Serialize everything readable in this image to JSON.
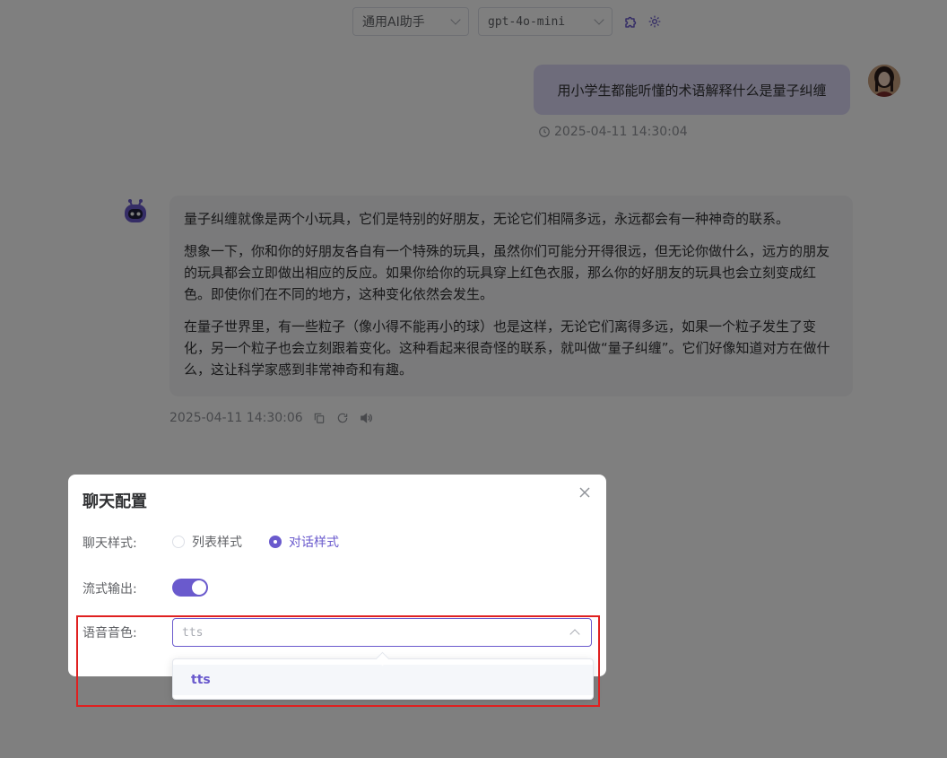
{
  "header": {
    "role_select": "通用AI助手",
    "model_select": "gpt-4o-mini",
    "plugin_icon": "puzzle-icon",
    "settings_icon": "gear-icon"
  },
  "user_message": {
    "text": "用小学生都能听懂的术语解释什么是量子纠缠",
    "time": "2025-04-11 14:30:04"
  },
  "bot_message": {
    "paragraphs": [
      "量子纠缠就像是两个小玩具，它们是特别的好朋友，无论它们相隔多远，永远都会有一种神奇的联系。",
      "想象一下，你和你的好朋友各自有一个特殊的玩具，虽然你们可能分开得很远，但无论你做什么，远方的朋友的玩具都会立即做出相应的反应。如果你给你的玩具穿上红色衣服，那么你的好朋友的玩具也会立刻变成红色。即使你们在不同的地方，这种变化依然会发生。",
      "在量子世界里，有一些粒子（像小得不能再小的球）也是这样，无论它们离得多远，如果一个粒子发生了变化，另一个粒子也会立刻跟着变化。这种看起来很奇怪的联系，就叫做“量子纠缠”。它们好像知道对方在做什么，这让科学家感到非常神奇和有趣。"
    ],
    "time": "2025-04-11 14:30:06"
  },
  "dialog": {
    "title": "聊天配置",
    "chat_style_label": "聊天样式:",
    "style_options": [
      "列表样式",
      "对话样式"
    ],
    "selected_style": "对话样式",
    "stream_label": "流式输出:",
    "stream_on": true,
    "voice_label": "语音音色:",
    "voice_placeholder": "tts",
    "voice_options": [
      "tts"
    ]
  },
  "colors": {
    "accent": "#6a5acd",
    "user_bubble": "#dcd9f6",
    "highlight": "#e02020"
  }
}
